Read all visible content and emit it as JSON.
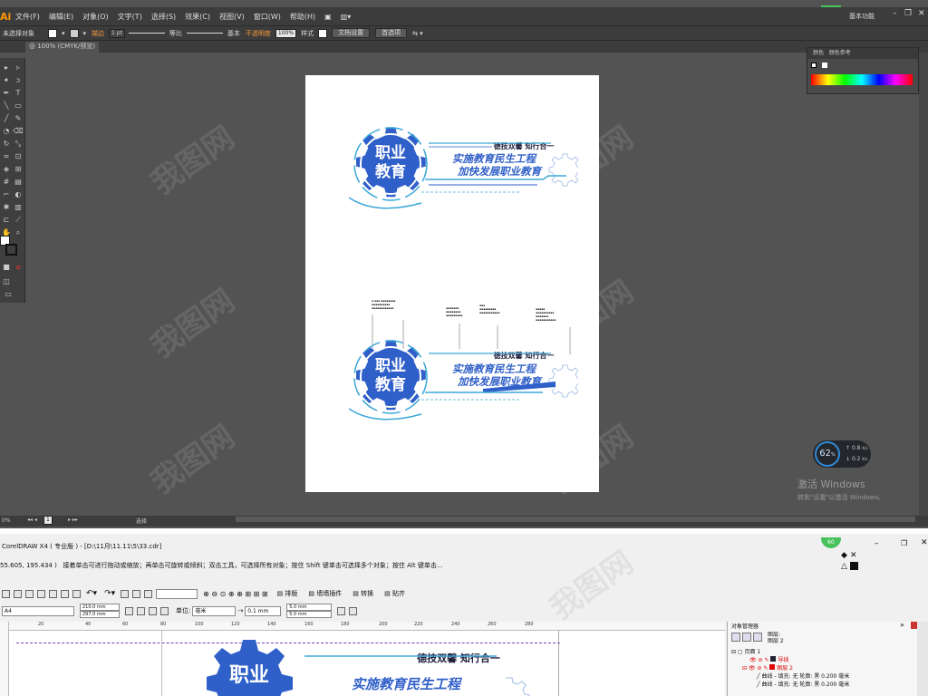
{
  "illustrator": {
    "logo": "Ai",
    "menu": [
      "文件(F)",
      "编辑(E)",
      "对象(O)",
      "文字(T)",
      "选择(S)",
      "效果(C)",
      "视图(V)",
      "窗口(W)",
      "帮助(H)"
    ],
    "badge": "62",
    "workspace": "基本功能",
    "control": {
      "no_selection": "未选择对象",
      "stroke_label": "描边",
      "stroke_value": "1 pt",
      "uniform": "等比",
      "basic": "基本",
      "opacity_label": "不透明度",
      "opacity_value": "100%",
      "style_label": "样式",
      "doc_setup": "文档设置",
      "preferences": "首选项"
    },
    "doc_tab": "@ 100% (CMYK/预览)",
    "status_zoom": "0%",
    "status_page": "1",
    "status_tool": "选择",
    "color_panel": {
      "tab1": "颜色",
      "tab2": "颜色参考"
    },
    "logo_art": {
      "gear_line1": "职业",
      "gear_line2": "教育",
      "slogan": "德技双馨  知行合一",
      "main_line1": "实施教育民生工程",
      "main_line2": "加快发展职业教育"
    },
    "perf": {
      "pct": "62",
      "unit": "%",
      "up": "0.8",
      "down": "0.2",
      "rate_unit": "K/s"
    },
    "activate": {
      "title": "激活 Windows",
      "hint": "转到\"设置\"以激活 Windows。"
    }
  },
  "coreldraw": {
    "title": "CorelDRAW X4 ( 专业版 ) - [D:\\11月\\11.11\\5\\33.cdr]",
    "badge": "60",
    "hint_coords": "55.605, 195.434 )",
    "hint": "接着单击可进行拖动或缩放；再单击可旋转或倾斜；双击工具，可选择所有对象；按住 Shift 键单击可选择多个对象；按住 Alt 键单击...",
    "toolbar": {
      "arrange": "排版",
      "wall": "墙墙插件",
      "convert": "转换",
      "paste": "贴齐"
    },
    "page_size": "A4",
    "width": "210.0 mm",
    "height": "297.0 mm",
    "unit_label": "单位:",
    "unit": "毫米",
    "nudge": "0.1 mm",
    "dup_x": "5.0 mm",
    "dup_y": "5.0 mm",
    "ruler": [
      "20",
      "40",
      "60",
      "80",
      "100",
      "120",
      "140",
      "160",
      "180",
      "200",
      "220",
      "240",
      "260",
      "280"
    ],
    "object_manager": {
      "title": "对象管理器",
      "layers": [
        "图层:",
        "图层 2"
      ],
      "page": "页面 1",
      "guides": "导线",
      "layer": "图层 2",
      "curve1": "曲线 - 填充: 无  轮廓: 黑  0.200 毫米",
      "curve2": "曲线 - 填充: 无  轮廓: 黑  0.200 毫米"
    }
  },
  "colors": {
    "accent_blue": "#2f5fc8",
    "cyan": "#3aa7d8",
    "ai_bg": "#535353",
    "ai_bar": "#3c3c3c"
  }
}
